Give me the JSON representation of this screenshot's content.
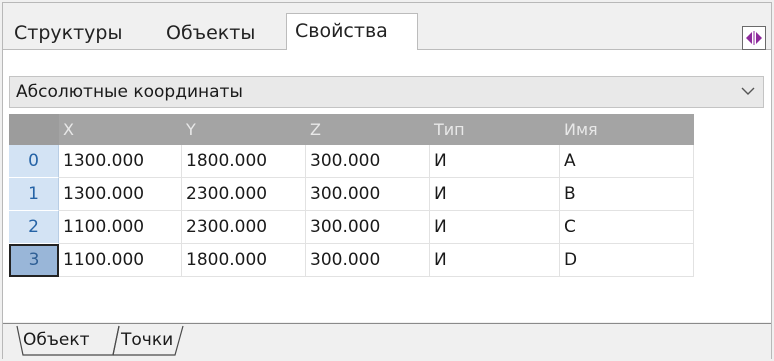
{
  "tabs": [
    {
      "label": "Структуры"
    },
    {
      "label": "Объекты"
    },
    {
      "label": "Свойства",
      "active": true
    }
  ],
  "corner_button": {
    "icon": "split-arrows-icon",
    "color": "#8e2a9c"
  },
  "dropdown": {
    "value": "Абсолютные координаты"
  },
  "table": {
    "columns": [
      "X",
      "Y",
      "Z",
      "Тип",
      "Имя"
    ],
    "rows": [
      {
        "index": "0",
        "x": "1300.000",
        "y": "1800.000",
        "z": "300.000",
        "type": "И",
        "name": "A"
      },
      {
        "index": "1",
        "x": "1300.000",
        "y": "2300.000",
        "z": "300.000",
        "type": "И",
        "name": "B"
      },
      {
        "index": "2",
        "x": "1100.000",
        "y": "2300.000",
        "z": "300.000",
        "type": "И",
        "name": "C"
      },
      {
        "index": "3",
        "x": "1100.000",
        "y": "1800.000",
        "z": "300.000",
        "type": "И",
        "name": "D",
        "selected": true
      }
    ]
  },
  "bottom_tabs": [
    {
      "label": "Объект"
    },
    {
      "label": "Точки",
      "active": true
    }
  ]
}
